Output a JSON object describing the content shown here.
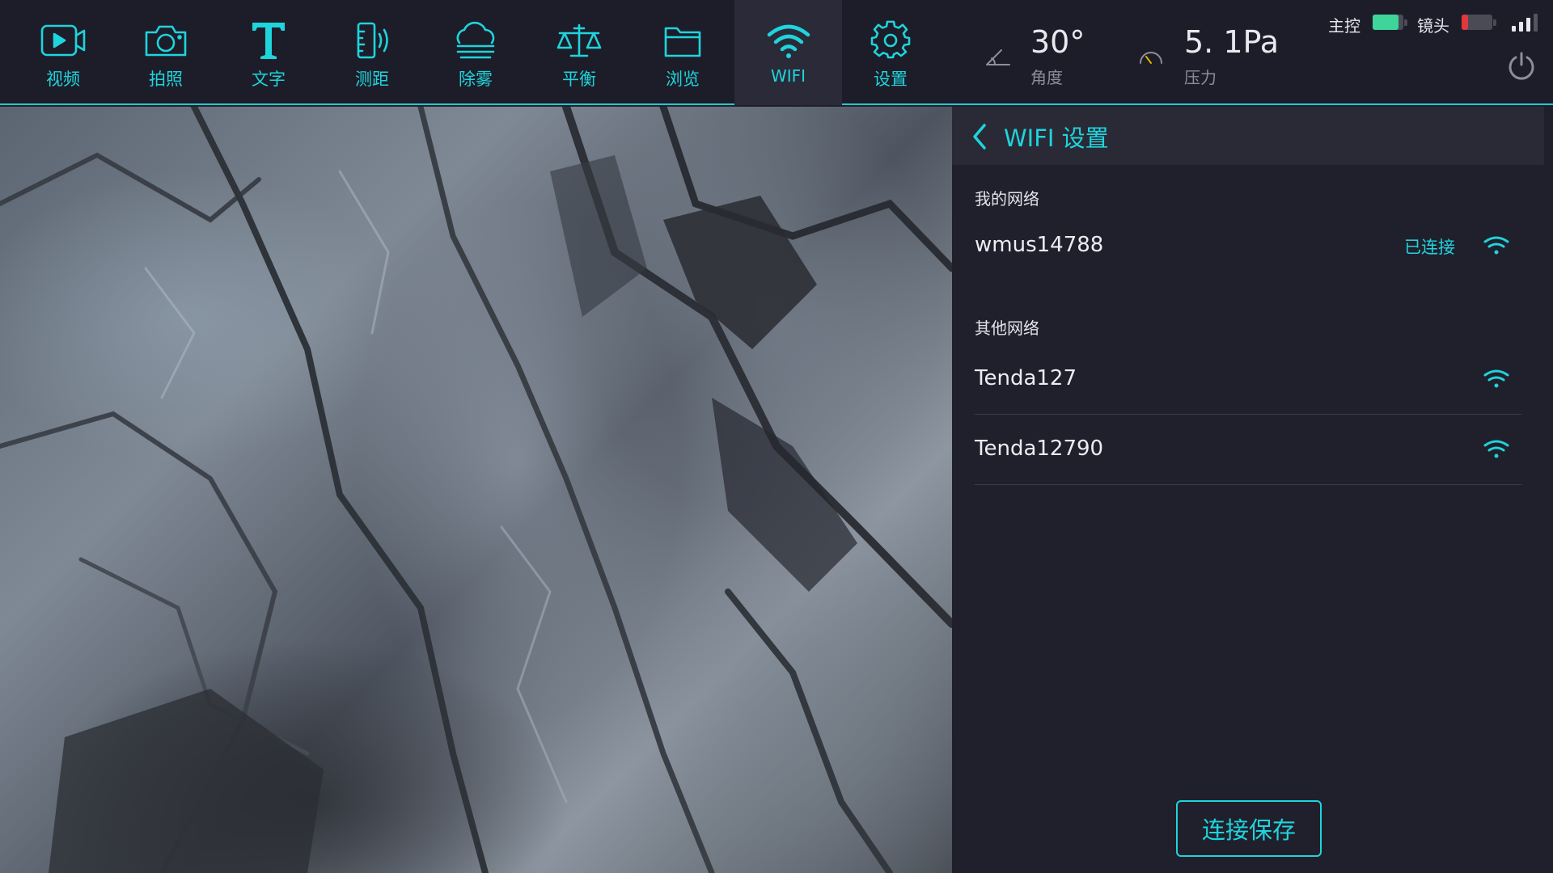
{
  "toolbar": {
    "items": [
      {
        "label": "视频",
        "icon": "video-icon"
      },
      {
        "label": "拍照",
        "icon": "camera-icon"
      },
      {
        "label": "文字",
        "icon": "text-icon"
      },
      {
        "label": "测距",
        "icon": "distance-icon"
      },
      {
        "label": "除雾",
        "icon": "defog-icon"
      },
      {
        "label": "平衡",
        "icon": "balance-icon"
      },
      {
        "label": "浏览",
        "icon": "folder-icon"
      },
      {
        "label": "WIFI",
        "icon": "wifi-icon",
        "active": true
      },
      {
        "label": "设置",
        "icon": "gear-icon"
      }
    ]
  },
  "readouts": {
    "angle": {
      "value": "30°",
      "label": "角度"
    },
    "pressure": {
      "value": "5. 1Pa",
      "label": "压力"
    }
  },
  "status": {
    "main_label": "主控",
    "main_battery_level": 0.85,
    "main_battery_color": "#3fd49a",
    "lens_label": "镜头",
    "lens_battery_level": 0.2,
    "lens_battery_color": "#e0383e",
    "signal_bars": 3
  },
  "wifi_panel": {
    "title": "WIFI 设置",
    "my_networks_title": "我的网络",
    "my_networks": [
      {
        "name": "wmus14788",
        "status": "已连接"
      }
    ],
    "other_networks_title": "其他网络",
    "other_networks": [
      {
        "name": "Tenda127"
      },
      {
        "name": "Tenda12790"
      }
    ],
    "save_button": "连接保存"
  },
  "colors": {
    "accent": "#1fd4dc",
    "background": "#1d1d29"
  }
}
